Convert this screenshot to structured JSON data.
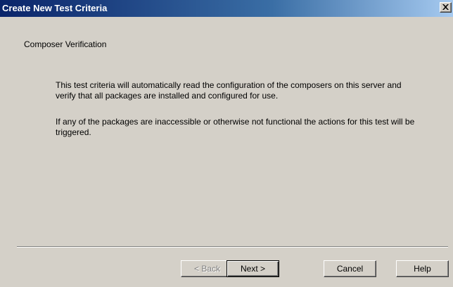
{
  "window": {
    "title": "Create New Test Criteria"
  },
  "page": {
    "subtitle": "Composer Verification",
    "paragraph1": "This test criteria will automatically read the configuration of the composers on this server and verify that all packages are installed and configured for use.",
    "paragraph2": "If any of the packages are inaccessible or otherwise not functional the actions for this test will be triggered."
  },
  "buttons": {
    "back": "< Back",
    "next": "Next >",
    "cancel": "Cancel",
    "help": "Help"
  },
  "colors": {
    "titlebar_start": "#0a246a",
    "titlebar_end": "#a6caf0",
    "dialog_bg": "#d4d0c8"
  },
  "icons": {
    "close": "close-icon"
  }
}
